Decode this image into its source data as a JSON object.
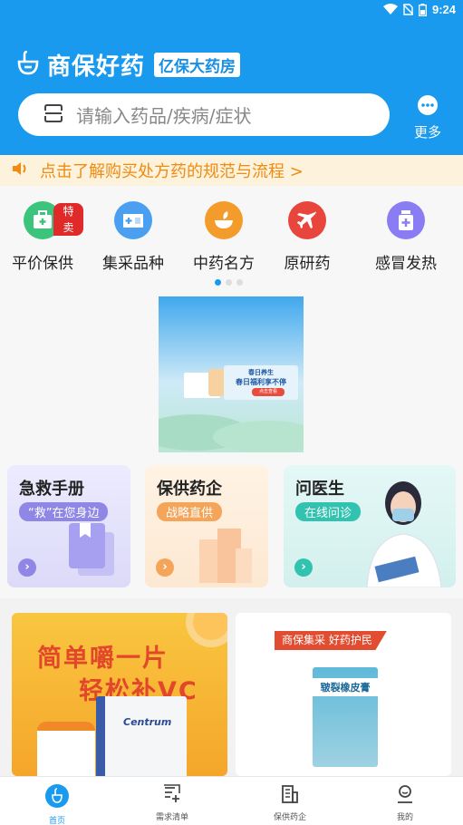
{
  "status_bar": {
    "time": "9:24",
    "icons": [
      "wifi-icon",
      "no-sim-icon",
      "battery-icon"
    ]
  },
  "header": {
    "app_title": "商保好药",
    "badge": "亿保大药房",
    "search_placeholder": "请输入药品/疾病/症状",
    "more_label": "更多",
    "color": "#1a9aee"
  },
  "notice": {
    "text": "点击了解购买处方药的规范与流程 >"
  },
  "categories": [
    {
      "label": "平价保供",
      "icon": "medkit-icon",
      "tag": "特卖",
      "color": "#3cc47c"
    },
    {
      "label": "集采品种",
      "icon": "hospital-icon",
      "color": "#4a9ff0"
    },
    {
      "label": "中药名方",
      "icon": "herb-bowl-icon",
      "color": "#f39c2b"
    },
    {
      "label": "原研药",
      "icon": "airplane-icon",
      "color": "#e8453c"
    },
    {
      "label": "感冒发热",
      "icon": "medicine-bottle-icon",
      "color": "#8a7cf2"
    }
  ],
  "banner": {
    "line1": "春日养生",
    "line2": "春日福利享不停",
    "button": "点击查看"
  },
  "features": [
    {
      "title": "急救手册",
      "subtitle": "“救”在您身边"
    },
    {
      "title": "保供药企",
      "subtitle": "战略直供"
    },
    {
      "title": "问医生",
      "subtitle": "在线问诊"
    }
  ],
  "products": {
    "vc": {
      "line1": "简单嚼一片",
      "line2": "轻松补VC",
      "brand": "Centrum"
    },
    "tape": {
      "tag": "商保集采  好药护民",
      "label": "皲裂橡皮膏"
    }
  },
  "tabbar": [
    {
      "label": "首页",
      "icon": "home-icon",
      "active": true
    },
    {
      "label": "需求清单",
      "icon": "list-add-icon"
    },
    {
      "label": "保供药企",
      "icon": "building-icon"
    },
    {
      "label": "我的",
      "icon": "user-icon"
    }
  ]
}
